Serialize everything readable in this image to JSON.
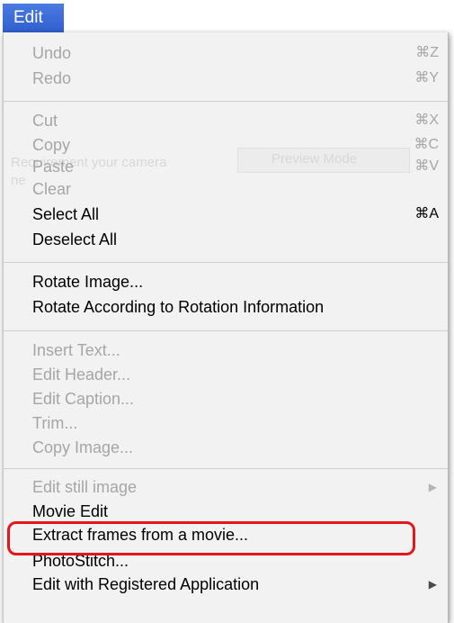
{
  "menu_bar": {
    "title": "Edit"
  },
  "background_hints": {
    "line1": "Requirement your camera",
    "line2": "Preview Mode",
    "line3": "ne"
  },
  "menu": {
    "items": [
      {
        "label": "Undo",
        "shortcut": "⌘Z",
        "enabled": false
      },
      {
        "label": "Redo",
        "shortcut": "⌘Y",
        "enabled": false
      },
      {
        "label": "Cut",
        "shortcut": "⌘X",
        "enabled": false
      },
      {
        "label": "Copy",
        "shortcut": "⌘C",
        "enabled": false
      },
      {
        "label": "Paste",
        "shortcut": "⌘V",
        "enabled": false
      },
      {
        "label": "Clear",
        "shortcut": "",
        "enabled": false
      },
      {
        "label": "Select All",
        "shortcut": "⌘A",
        "enabled": true
      },
      {
        "label": "Deselect All",
        "shortcut": "",
        "enabled": true
      },
      {
        "label": "Rotate Image...",
        "shortcut": "",
        "enabled": true
      },
      {
        "label": "Rotate According to Rotation Information",
        "shortcut": "",
        "enabled": true
      },
      {
        "label": "Insert Text...",
        "shortcut": "",
        "enabled": false
      },
      {
        "label": "Edit Header...",
        "shortcut": "",
        "enabled": false
      },
      {
        "label": "Edit Caption...",
        "shortcut": "",
        "enabled": false
      },
      {
        "label": "Trim...",
        "shortcut": "",
        "enabled": false
      },
      {
        "label": "Copy Image...",
        "shortcut": "",
        "enabled": false
      },
      {
        "label": "Edit still image",
        "shortcut": "",
        "enabled": false,
        "submenu": true
      },
      {
        "label": "Movie Edit",
        "shortcut": "",
        "enabled": true
      },
      {
        "label": "Extract frames from a movie...",
        "shortcut": "",
        "enabled": true,
        "highlighted": true
      },
      {
        "label": "PhotoStitch...",
        "shortcut": "",
        "enabled": true
      },
      {
        "label": "Edit with Registered Application",
        "shortcut": "",
        "enabled": true,
        "submenu": true
      }
    ]
  },
  "colors": {
    "menu_title_bg": "#3a6bd8",
    "highlight_ring": "#e4161b",
    "enabled_text": "#000000",
    "disabled_text": "#a6a6a6"
  }
}
